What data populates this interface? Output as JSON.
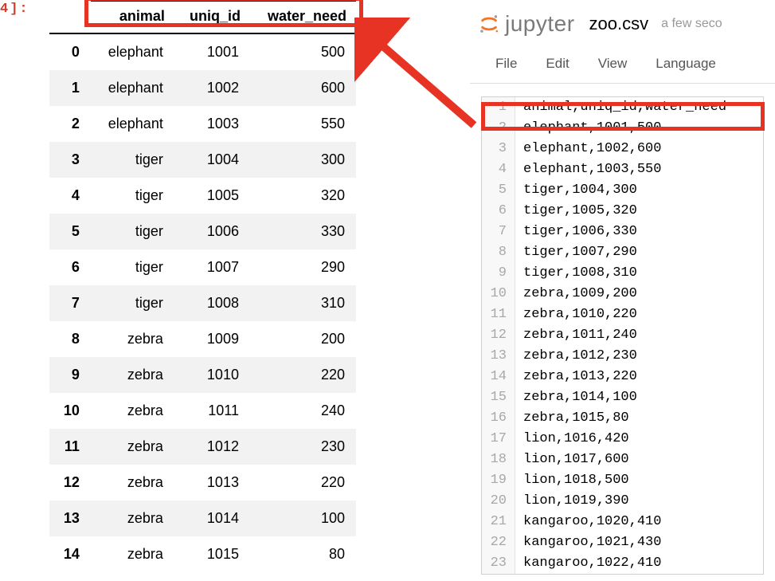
{
  "prompt_label": "4]:",
  "dataframe": {
    "columns": [
      "animal",
      "uniq_id",
      "water_need"
    ],
    "rows": [
      {
        "idx": "0",
        "animal": "elephant",
        "uniq_id": "1001",
        "water_need": "500"
      },
      {
        "idx": "1",
        "animal": "elephant",
        "uniq_id": "1002",
        "water_need": "600"
      },
      {
        "idx": "2",
        "animal": "elephant",
        "uniq_id": "1003",
        "water_need": "550"
      },
      {
        "idx": "3",
        "animal": "tiger",
        "uniq_id": "1004",
        "water_need": "300"
      },
      {
        "idx": "4",
        "animal": "tiger",
        "uniq_id": "1005",
        "water_need": "320"
      },
      {
        "idx": "5",
        "animal": "tiger",
        "uniq_id": "1006",
        "water_need": "330"
      },
      {
        "idx": "6",
        "animal": "tiger",
        "uniq_id": "1007",
        "water_need": "290"
      },
      {
        "idx": "7",
        "animal": "tiger",
        "uniq_id": "1008",
        "water_need": "310"
      },
      {
        "idx": "8",
        "animal": "zebra",
        "uniq_id": "1009",
        "water_need": "200"
      },
      {
        "idx": "9",
        "animal": "zebra",
        "uniq_id": "1010",
        "water_need": "220"
      },
      {
        "idx": "10",
        "animal": "zebra",
        "uniq_id": "1011",
        "water_need": "240"
      },
      {
        "idx": "11",
        "animal": "zebra",
        "uniq_id": "1012",
        "water_need": "230"
      },
      {
        "idx": "12",
        "animal": "zebra",
        "uniq_id": "1013",
        "water_need": "220"
      },
      {
        "idx": "13",
        "animal": "zebra",
        "uniq_id": "1014",
        "water_need": "100"
      },
      {
        "idx": "14",
        "animal": "zebra",
        "uniq_id": "1015",
        "water_need": "80"
      }
    ]
  },
  "jupyter": {
    "logo_text": "jupyter",
    "filename": "zoo.csv",
    "ago": "a few seco",
    "menu": [
      "File",
      "Edit",
      "View",
      "Language"
    ],
    "lines": [
      "animal,uniq_id,water_need",
      "elephant,1001,500",
      "elephant,1002,600",
      "elephant,1003,550",
      "tiger,1004,300",
      "tiger,1005,320",
      "tiger,1006,330",
      "tiger,1007,290",
      "tiger,1008,310",
      "zebra,1009,200",
      "zebra,1010,220",
      "zebra,1011,240",
      "zebra,1012,230",
      "zebra,1013,220",
      "zebra,1014,100",
      "zebra,1015,80",
      "lion,1016,420",
      "lion,1017,600",
      "lion,1018,500",
      "lion,1019,390",
      "kangaroo,1020,410",
      "kangaroo,1021,430",
      "kangaroo,1022,410"
    ]
  },
  "colors": {
    "highlight_red": "#e73323"
  }
}
